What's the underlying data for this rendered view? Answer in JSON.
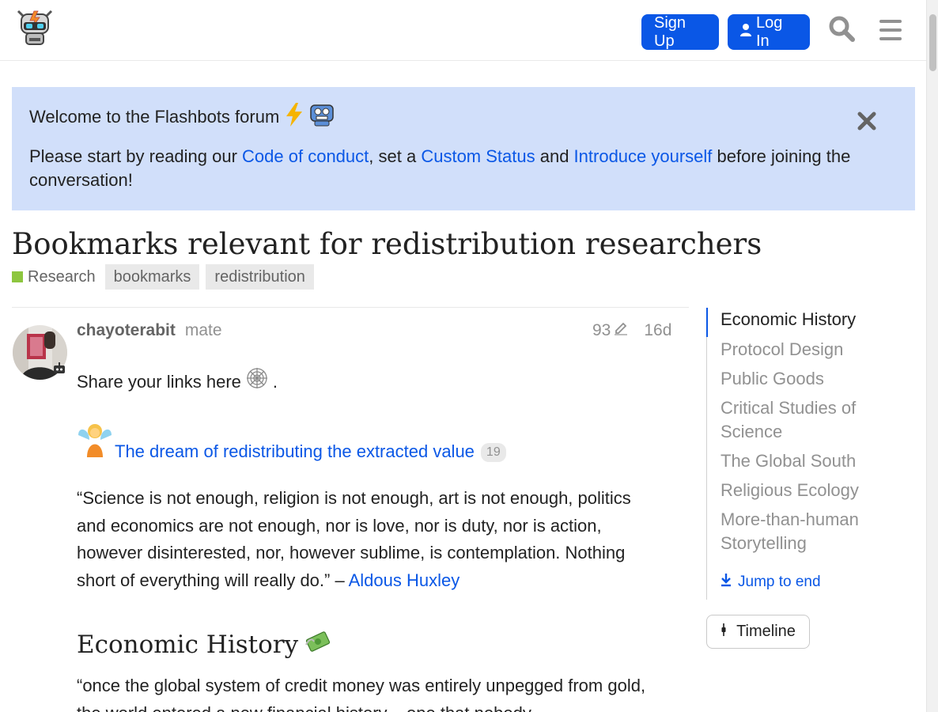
{
  "header": {
    "signup_label": "Sign Up",
    "login_label": "Log In"
  },
  "banner": {
    "welcome": "Welcome to the Flashbots forum",
    "desc_pre": "Please start by reading our ",
    "link_conduct": "Code of conduct",
    "desc_mid1": ", set a ",
    "link_status": "Custom Status",
    "desc_mid2": " and ",
    "link_intro": "Introduce yourself",
    "desc_post": " before joining the conversation!"
  },
  "topic": {
    "title": "Bookmarks relevant for redistribution researchers",
    "category": "Research",
    "category_color": "#8dc63f",
    "tags": [
      "bookmarks",
      "redistribution"
    ]
  },
  "post": {
    "username": "chayoterabit",
    "user_title": "mate",
    "edit_count": "93",
    "age": "16d",
    "share_text": "Share your links here",
    "share_end": ".",
    "link_title": "The dream of redistributing the extracted value",
    "link_clicks": "19",
    "quote": "“Science is not enough, religion is not enough, art is not enough, politics and economics are not enough, nor is love, nor is duty, nor is action, however disinterested, nor, however sublime, is contemplation. Nothing short of everything will really do.” – ",
    "quote_author": "Aldous Huxley",
    "heading": "Economic History",
    "quote2": "“once the global system of credit money was entirely unpegged from gold, the world entered a new financial history – one that nobody"
  },
  "toc": {
    "items": [
      "Economic History",
      "Protocol Design",
      "Public Goods",
      "Critical Studies of Science",
      "The Global South",
      "Religious Ecology",
      "More-than-human Storytelling"
    ],
    "jump_label": "Jump to end",
    "timeline_label": "Timeline"
  },
  "colors": {
    "accent": "#0a57e6",
    "banner_bg": "#d1dffa"
  }
}
